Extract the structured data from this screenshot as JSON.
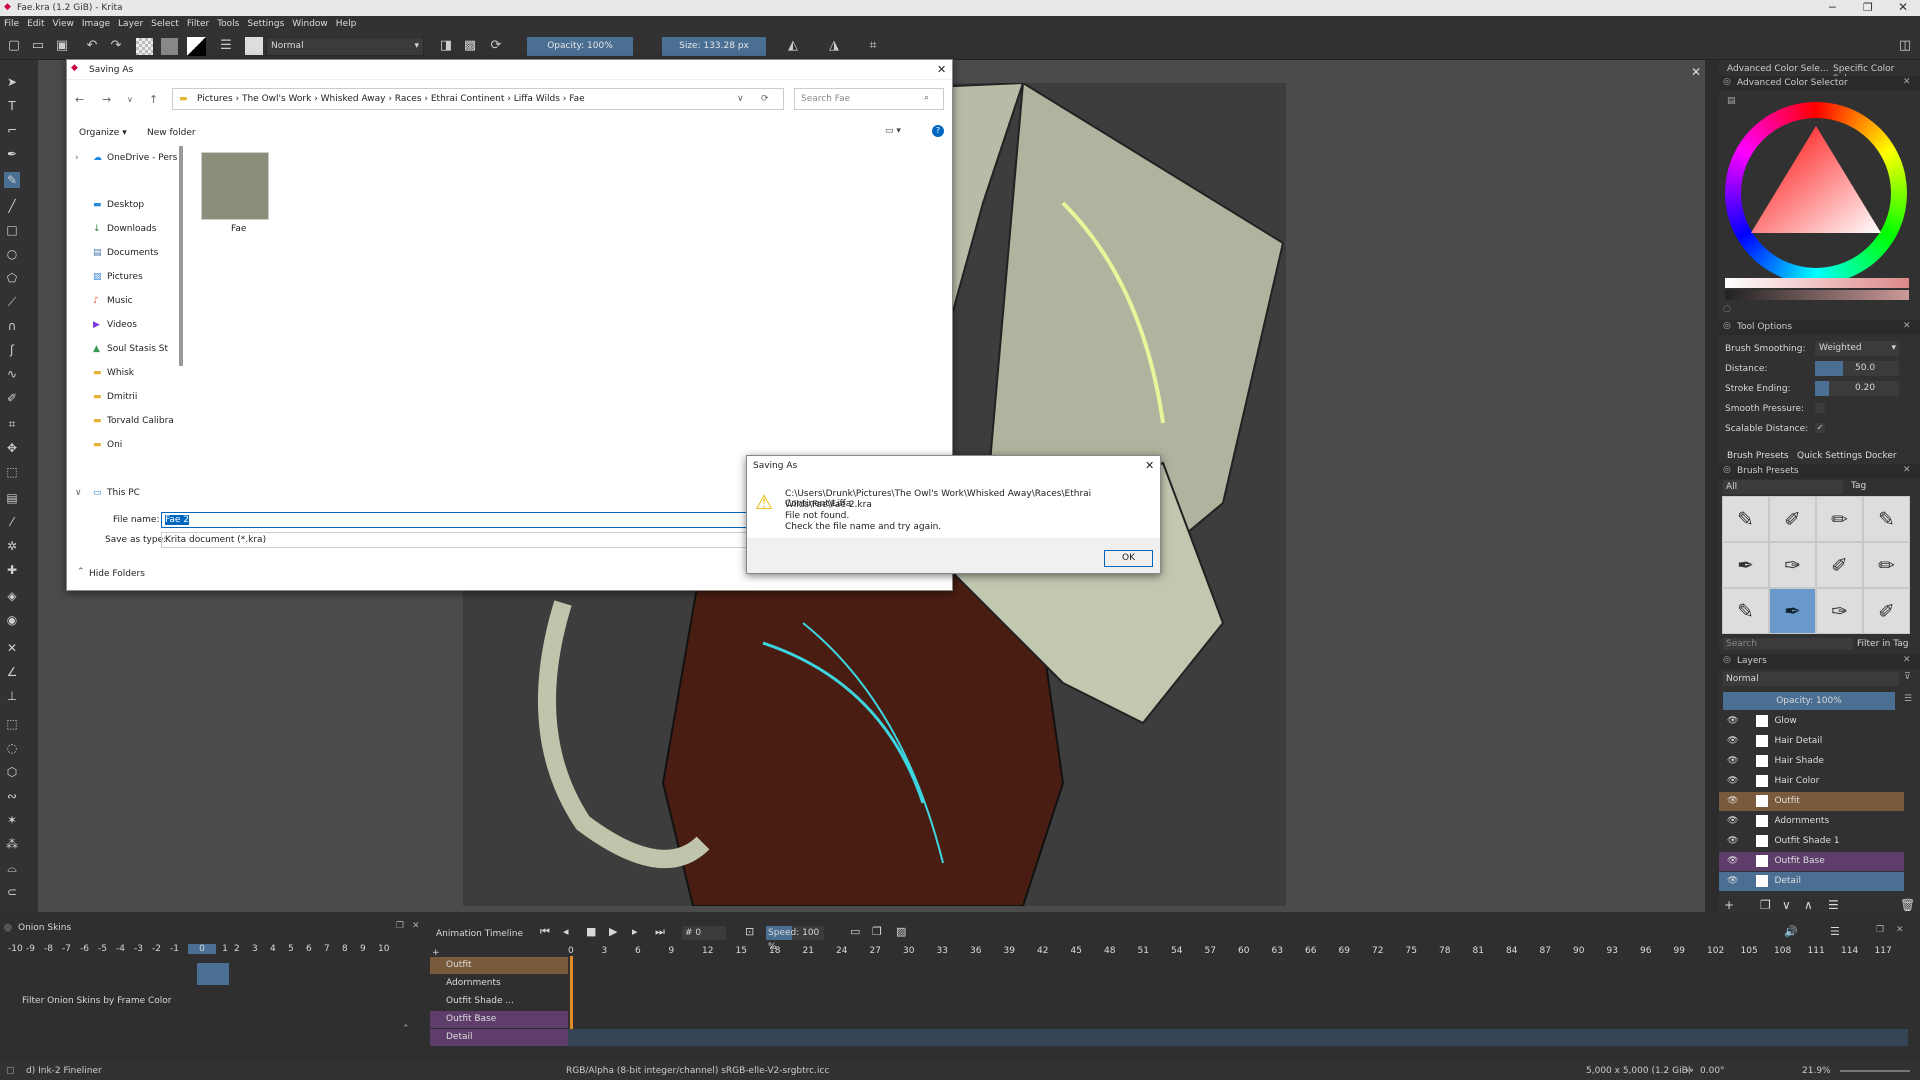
{
  "window": {
    "title": "Fae.kra (1.2 GiB) - Krita"
  },
  "menu": [
    "File",
    "Edit",
    "View",
    "Image",
    "Layer",
    "Select",
    "Filter",
    "Tools",
    "Settings",
    "Window",
    "Help"
  ],
  "toolbar": {
    "blend_mode": "Normal",
    "opacity": "Opacity: 100%",
    "size": "Size: 133.28 px"
  },
  "save_dialog": {
    "title": "Saving As",
    "breadcrumb": [
      "Pictures",
      "The Owl's Work",
      "Whisked Away",
      "Races",
      "Ethrai Continent",
      "Liffa Wilds",
      "Fae"
    ],
    "search_placeholder": "Search Fae",
    "organize": "Organize",
    "new_folder": "New folder",
    "nav": [
      "OneDrive - Pers",
      "Desktop",
      "Downloads",
      "Documents",
      "Pictures",
      "Music",
      "Videos",
      "Soul Stasis St",
      "Whisk",
      "Dmitrii",
      "Torvald Calibra",
      "Oni",
      "This PC"
    ],
    "file_item": "Fae",
    "file_name_label": "File name:",
    "file_name": "Fae 2",
    "save_type_label": "Save as type:",
    "save_type": "Krita document (*.kra)",
    "hide_folders": "Hide Folders"
  },
  "error_dialog": {
    "title": "Saving As",
    "message_line1": "C:\\Users\\Drunk\\Pictures\\The Owl's Work\\Whisked Away\\Races\\Ethrai Continent\\Liffa",
    "message_line2": "Wilds\\Fae\\Fae 2.kra",
    "message_line3": "File not found.",
    "message_line4": "Check the file name and try again.",
    "ok": "OK"
  },
  "right": {
    "tab1": "Advanced Color Sele...",
    "tab2": "Specific Color Sele...",
    "color_title": "Advanced Color Selector",
    "tool_options": "Tool Options",
    "brush_smoothing_label": "Brush Smoothing:",
    "brush_smoothing": "Weighted",
    "distance_label": "Distance:",
    "distance": "50.0",
    "stroke_ending_label": "Stroke Ending:",
    "stroke_ending": "0.20",
    "smooth_pressure": "Smooth Pressure:",
    "scalable_distance": "Scalable Distance:",
    "brush_presets_tab": "Brush Presets",
    "quick_settings_tab": "Quick Settings Docker",
    "brush_presets_title": "Brush Presets",
    "preset_filter": "All",
    "tag": "Tag",
    "search": "Search",
    "filter_in_tag": "Filter in Tag",
    "layers_title": "Layers",
    "layers_blend": "Normal",
    "layers_opacity": "Opacity: 100%",
    "layers": [
      "Glow",
      "Hair Detail",
      "Hair Shade",
      "Hair Color",
      "Outfit",
      "Adornments",
      "Outfit Shade 1",
      "Outfit Base",
      "Detail"
    ]
  },
  "bottom": {
    "onion_title": "Onion Skins",
    "onion_numbers": [
      "-10",
      "-9",
      "-8",
      "-7",
      "-6",
      "-5",
      "-4",
      "-3",
      "-2",
      "-1",
      "0",
      "1",
      "2",
      "3",
      "4",
      "5",
      "6",
      "7",
      "8",
      "9",
      "10"
    ],
    "filter_onion": "Filter Onion Skins by Frame Color",
    "timeline_title": "Animation Timeline",
    "frame": "0",
    "speed": "Speed: 100 %",
    "frame_numbers": [
      "0",
      "3",
      "6",
      "9",
      "12",
      "15",
      "18",
      "21",
      "24",
      "27",
      "30",
      "33",
      "36",
      "39",
      "42",
      "45",
      "48",
      "51",
      "54",
      "57",
      "60",
      "63",
      "66",
      "69",
      "72",
      "75",
      "78",
      "81",
      "84",
      "87",
      "90",
      "93",
      "96",
      "99",
      "102",
      "105",
      "108",
      "111",
      "114",
      "117"
    ],
    "timeline_layers": [
      "Outfit",
      "Adornments",
      "Outfit Shade ...",
      "Outfit Base",
      "Detail"
    ]
  },
  "status": {
    "brush": "d) Ink-2 Fineliner",
    "color_space": "RGB/Alpha (8-bit integer/channel)  sRGB-elle-V2-srgbtrc.icc",
    "dimensions": "5,000 x 5,000 (1.2 GiB)",
    "rotation": "0.00°",
    "zoom": "21.9%"
  }
}
